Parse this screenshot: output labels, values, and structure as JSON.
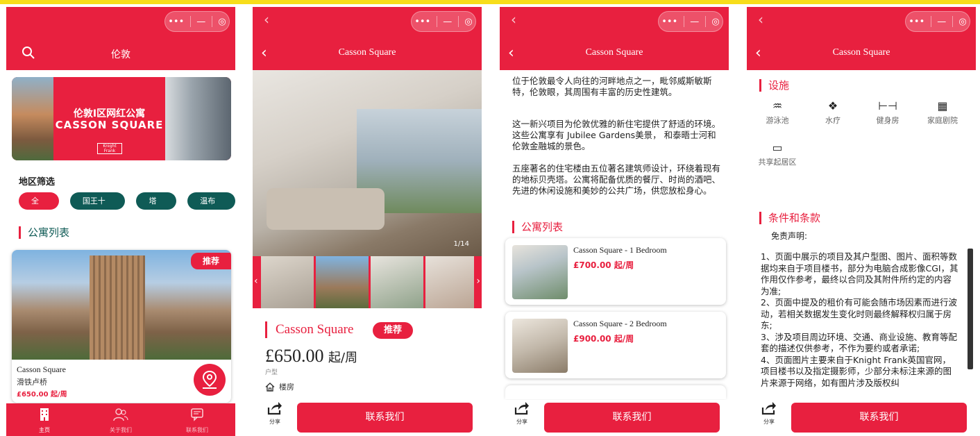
{
  "capsule": {
    "more": "•••",
    "minimize": "—",
    "close": "◎"
  },
  "panel1": {
    "nav_title": "伦敦",
    "banner": {
      "line1": "伦敦I区网红公寓",
      "line2": "CASSON SQUARE",
      "brand": "Knight Frank"
    },
    "filter_title": "地区筛选",
    "chips": [
      "全部",
      "国王十字",
      "塔桥",
      "温布利"
    ],
    "section_title": "公寓列表",
    "card": {
      "badge": "推荐",
      "name": "Casson Square",
      "location": "滑铁卢桥",
      "price": "£650.00 起/周"
    },
    "tabs": [
      "主页",
      "关于我们",
      "联系我们"
    ]
  },
  "panel2": {
    "nav_title": "Casson Square",
    "gallery_counter": "1/14",
    "title": "Casson Square",
    "badge": "推荐",
    "price": "£650.00",
    "price_unit": "起/周",
    "type_label": "户型",
    "building": "楼房",
    "share": "分享",
    "contact": "联系我们"
  },
  "panel3": {
    "nav_title": "Casson Square",
    "paragraphs": [
      "位于伦敦最令人向往的河畔地点之一，毗邻威斯敏斯特，伦敦眼，其周围有丰富的历史性建筑。",
      "这一新兴项目为伦敦优雅的新住宅提供了舒适的环境。这些公寓享有 Jubilee Gardens美景， 和泰晤士河和伦敦金融城的景色。",
      "五座著名的住宅楼由五位著名建筑师设计，环绕着现有的地标贝壳塔。公寓将配备优质的餐厅、时尚的酒吧、先进的休闲设施和美妙的公共广场，供您放松身心。"
    ],
    "section_title": "公寓列表",
    "units": [
      {
        "name": "Casson Square - 1 Bedroom",
        "price": "£700.00 起/周"
      },
      {
        "name": "Casson Square - 2 Bedroom",
        "price": "£900.00 起/周"
      }
    ],
    "share": "分享",
    "contact": "联系我们"
  },
  "panel4": {
    "nav_title": "Casson Square",
    "facilities_title": "设施",
    "facilities": [
      {
        "label": "游泳池",
        "icon": "pool-icon"
      },
      {
        "label": "水疗",
        "icon": "spa-icon"
      },
      {
        "label": "健身房",
        "icon": "gym-icon"
      },
      {
        "label": "家庭剧院",
        "icon": "cinema-icon"
      },
      {
        "label": "共享起居区",
        "icon": "lounge-icon"
      }
    ],
    "terms_title": "条件和条款",
    "disclaimer_title": "免责声明:",
    "terms": [
      "1、页面中展示的项目及其户型图、图片、面积等数据均来自于项目楼书，部分为电脑合成影像CGI，其作用仅作参考，最终以合同及其附件所约定的内容为准;",
      "2、页面中提及的租价有可能会随市场因素而进行波动，若相关数据发生变化时则最终解释权归属于房东;",
      "3、涉及项目周边环境、交通、商业设施、教育等配套的描述仅供参考，不作为要约或者承诺;",
      "4、页面图片主要来自于Knight Frank英国官网，项目楼书以及指定摄影师，少部分未标注来源的图片来源于网络，如有图片涉及版权纠"
    ],
    "share": "分享",
    "contact": "联系我们"
  },
  "colors": {
    "brand_red": "#e8203f",
    "teal": "#0f5b56",
    "top_strip": "#f7dd1b"
  }
}
